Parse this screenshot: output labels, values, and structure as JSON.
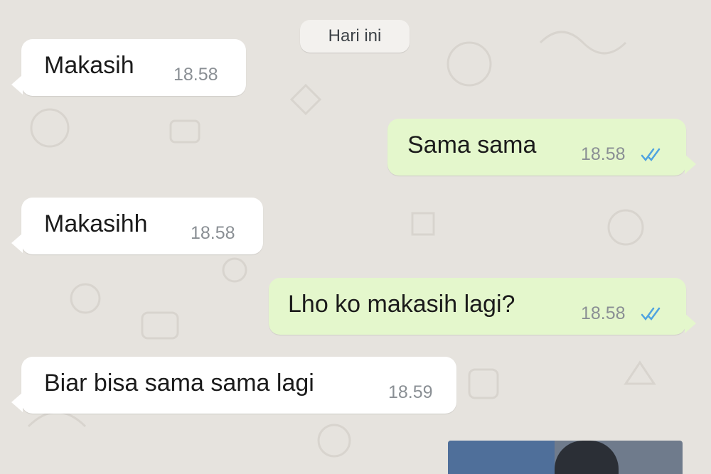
{
  "chat": {
    "date_label": "Hari ini",
    "colors": {
      "background": "#e6e3de",
      "incoming_bubble": "#ffffff",
      "outgoing_bubble": "#e4f7cc",
      "read_ticks": "#4fa3e0"
    },
    "messages": [
      {
        "direction": "incoming",
        "text": "Makasih",
        "time": "18.58"
      },
      {
        "direction": "outgoing",
        "text": "Sama sama",
        "time": "18.58",
        "status_icon": "double-check-read-icon"
      },
      {
        "direction": "incoming",
        "text": "Makasihh",
        "time": "18.58"
      },
      {
        "direction": "outgoing",
        "text": "Lho ko makasih lagi?",
        "time": "18.58",
        "status_icon": "double-check-read-icon"
      },
      {
        "direction": "incoming",
        "text": "Biar bisa sama sama lagi",
        "time": "18.59"
      }
    ],
    "media_preview": {
      "kind": "image"
    }
  }
}
